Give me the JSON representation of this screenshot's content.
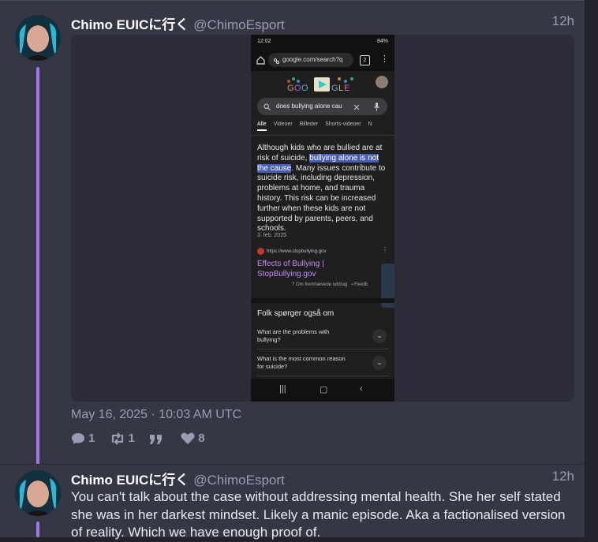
{
  "posts": [
    {
      "display_name": "Chimo EUICに行く",
      "handle": "@ChimoEsport",
      "time": "12h",
      "date": "May 16, 2025 · 10:03 AM UTC",
      "stats": {
        "replies": "1",
        "retweets": "1",
        "likes": "8"
      },
      "screenshot": {
        "status_time": "12:02",
        "battery": "84%",
        "url": "google.com/search?q",
        "tab_count": "2",
        "search_query": "does bullying alone cau",
        "tabs": [
          "Alle",
          "Videoer",
          "Billeder",
          "Shorts-videoer",
          "N"
        ],
        "snippet_before": "Although kids who are bullied are at risk of suicide, ",
        "snippet_highlight": "bullying alone is not the cause",
        "snippet_after": ". Many issues contribute to suicide risk, including depression, problems at home, and trauma history. This risk can be increased further when these kids are not supported by parents, peers, and schools.",
        "snippet_date": "3. feb. 2025",
        "source_url": "https://www.stopbullying.gov",
        "source_title": "Effects of Bullying | StopBullying.gov",
        "featured_note": "Om fremhævede uddrag",
        "feedback": "Feedb",
        "paa_title": "Folk spørger også om",
        "questions": [
          "What are the problems with bullying?",
          "What is the most common reason for suicide?"
        ]
      }
    },
    {
      "display_name": "Chimo EUICに行く",
      "handle": "@ChimoEsport",
      "time": "12h",
      "text": "You can't talk about the case without addressing mental health. She her self stated she was in her darkest mindset. Likely a manic episode. Aka a factionalised version of reality. Which we have enough proof of."
    }
  ],
  "colors": {
    "accent": "#a576ea",
    "link": "#c58af9",
    "muted": "#9a9cb5",
    "panel": "#363745"
  }
}
